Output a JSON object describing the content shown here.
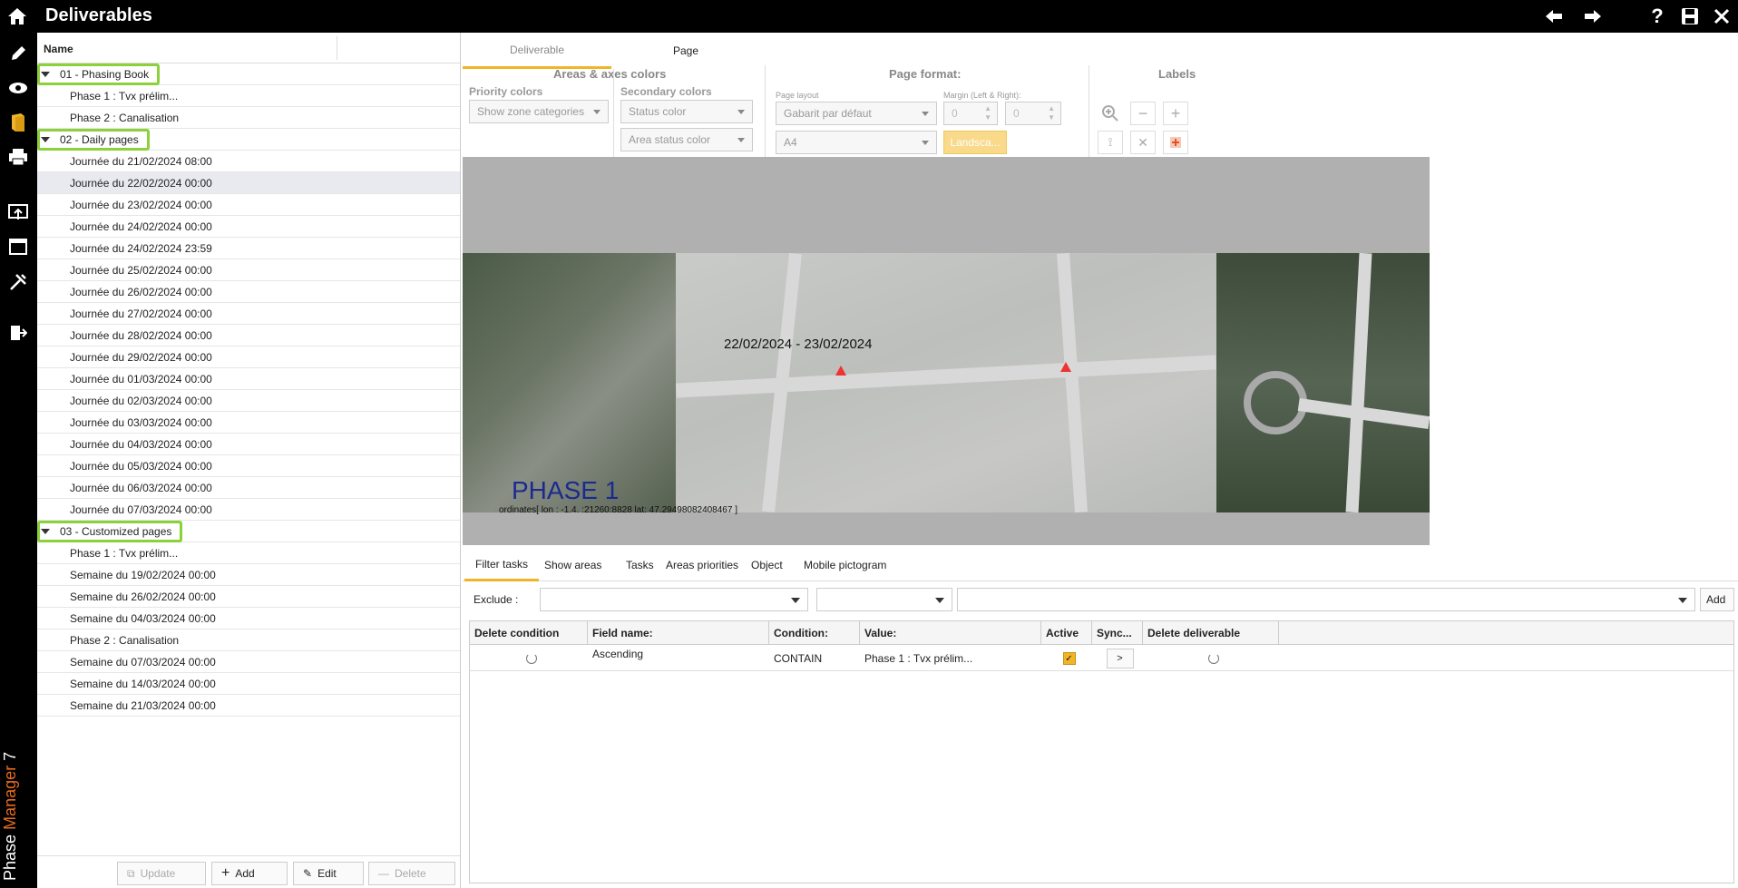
{
  "header": {
    "title": "Deliverables"
  },
  "rail": {
    "brand_phase": "Phase",
    "brand_manager": "Manager",
    "brand_version": "7"
  },
  "tree": {
    "column_name": "Name",
    "groups": [
      {
        "label": "01 - Phasing Book",
        "items": [
          "Phase 1 : Tvx prélim...",
          "Phase 2 : Canalisation"
        ]
      },
      {
        "label": "02 - Daily pages",
        "items": [
          "Journée du 21/02/2024 08:00",
          "Journée du 22/02/2024 00:00",
          "Journée du 23/02/2024 00:00",
          "Journée du 24/02/2024 00:00",
          "Journée du 24/02/2024 23:59",
          "Journée du 25/02/2024 00:00",
          "Journée du 26/02/2024 00:00",
          "Journée du 27/02/2024 00:00",
          "Journée du 28/02/2024 00:00",
          "Journée du 29/02/2024 00:00",
          "Journée du 01/03/2024 00:00",
          "Journée du 02/03/2024 00:00",
          "Journée du 03/03/2024 00:00",
          "Journée du 04/03/2024 00:00",
          "Journée du 05/03/2024 00:00",
          "Journée du 06/03/2024 00:00",
          "Journée du 07/03/2024 00:00"
        ]
      },
      {
        "label": "03 - Customized pages",
        "items": [
          "Phase 1 : Tvx prélim...",
          "Semaine du 19/02/2024 00:00",
          "Semaine du 26/02/2024 00:00",
          "Semaine du 04/03/2024 00:00",
          "Phase 2 : Canalisation",
          "Semaine du 07/03/2024 00:00",
          "Semaine du 14/03/2024 00:00",
          "Semaine du 21/03/2024 00:00"
        ]
      }
    ],
    "selected": "Journée du 22/02/2024 00:00",
    "buttons": {
      "update": "Update",
      "add": "Add",
      "edit": "Edit",
      "delete": "Delete"
    }
  },
  "top_tabs": {
    "deliverable": "Deliverable",
    "page": "Page"
  },
  "toolbar": {
    "areas_axes_title": "Areas & axes colors",
    "priority_colors": "Priority colors",
    "priority_combo": "Show zone categories",
    "secondary_colors": "Secondary colors",
    "status_color": "Status color",
    "area_status_color": "Area status color",
    "page_format_title": "Page format:",
    "page_layout": "Page layout",
    "page_layout_value": "Gabarit par défaut",
    "margin_label": "Margin (Left & Right):",
    "margin_left": "0",
    "margin_right": "0",
    "paper_size": "A4",
    "landscape": "Landsca...",
    "labels_title": "Labels"
  },
  "map": {
    "date_range": "22/02/2024 - 23/02/2024",
    "phase": "PHASE 1",
    "coords": "ordinates[ lon : -1.4.  :21260:8828 lat: 47.29498082408467 ]"
  },
  "bottom_tabs": [
    "Filter tasks",
    "Show areas",
    "Tasks",
    "Areas priorities",
    "Object",
    "Mobile pictogram"
  ],
  "filter": {
    "exclude_label": "Exclude :",
    "add_label": "Add"
  },
  "grid": {
    "columns": [
      "Delete condition",
      "Field name:",
      "Condition:",
      "Value:",
      "Active",
      "Sync...",
      "Delete deliverable"
    ],
    "rows": [
      {
        "field": "Ascending",
        "condition": "CONTAIN",
        "value": "Phase 1 : Tvx prélim...",
        "active": "✓",
        "sync": ">"
      }
    ]
  }
}
